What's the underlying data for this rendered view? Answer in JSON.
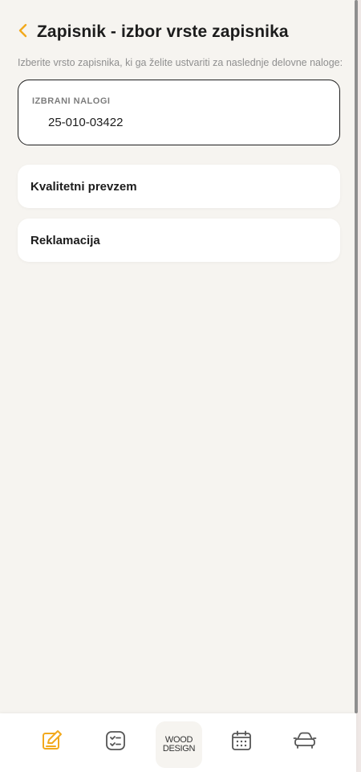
{
  "header": {
    "title": "Zapisnik - izbor vrste zapisnika",
    "back_icon": "chevron-left-icon",
    "accent_color": "#f2a91d"
  },
  "instructions": "Izberite vrsto zapisnika, ki ga želite ustvariti za naslednje delovne naloge:",
  "selected_orders": {
    "label": "IZBRANI NALOGI",
    "value": "25-010-03422"
  },
  "options": [
    {
      "label": "Kvalitetni prevzem"
    },
    {
      "label": "Reklamacija"
    }
  ],
  "bottom_nav": {
    "items": [
      {
        "icon": "edit-note-icon",
        "active": true
      },
      {
        "icon": "checklist-icon",
        "active": false
      },
      {
        "icon": "wood-design-logo",
        "logo_line1": "WOOD",
        "logo_line2": "DESIGN"
      },
      {
        "icon": "calendar-icon",
        "active": false
      },
      {
        "icon": "car-icon",
        "active": false
      }
    ]
  }
}
